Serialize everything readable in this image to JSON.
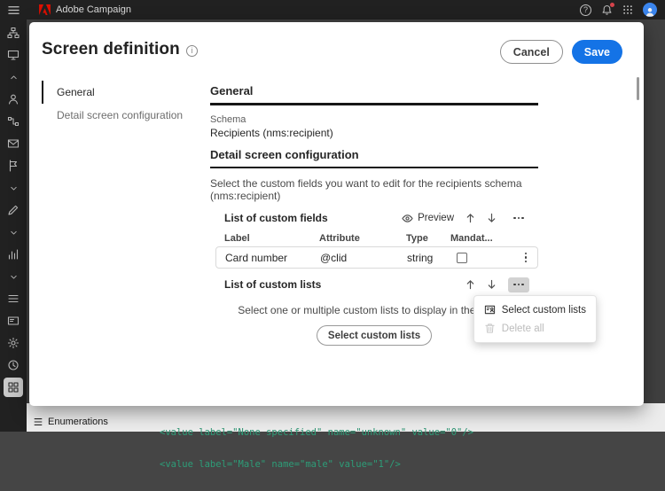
{
  "topbar": {
    "app_name": "Adobe Campaign"
  },
  "sidebar": {
    "icons": [
      "sitemap",
      "monitor",
      "chevron-up",
      "user",
      "workflow",
      "mail",
      "flag",
      "chevron-down",
      "compose",
      "chevron-down",
      "chart",
      "chevron-down",
      "list",
      "card",
      "settings",
      "history",
      "grid"
    ],
    "selected_icon": "grid"
  },
  "background": {
    "enumerations_label": "Enumerations",
    "code_lines": [
      "<value label=\"None specified\" name=\"unknown\" value=\"0\"/>",
      "<value label=\"Male\" name=\"male\" value=\"1\"/>"
    ]
  },
  "modal": {
    "title": "Screen definition",
    "actions": {
      "cancel": "Cancel",
      "save": "Save"
    },
    "nav": {
      "items": [
        {
          "label": "General"
        },
        {
          "label": "Detail screen configuration"
        }
      ],
      "active_index": 0
    },
    "general_section": {
      "heading": "General",
      "schema_label": "Schema",
      "schema_value": "Recipients (nms:recipient)"
    },
    "detail_section": {
      "heading": "Detail screen configuration",
      "description": "Select the custom fields you want to edit for the recipients schema (nms:recipient)",
      "custom_fields": {
        "title": "List of custom fields",
        "preview_label": "Preview",
        "table": {
          "headers": [
            "Label",
            "Attribute",
            "Type",
            "Mandat..."
          ],
          "row": {
            "label": "Card number",
            "attribute": "@clid",
            "type": "string",
            "mandatory_checked": false
          }
        }
      },
      "custom_lists": {
        "title": "List of custom lists",
        "description": "Select one or multiple custom lists to display in the screen",
        "button_label": "Select custom lists"
      }
    },
    "context_menu": {
      "items": [
        {
          "label": "Select custom lists",
          "disabled": false
        },
        {
          "label": "Delete all",
          "disabled": true
        }
      ]
    }
  },
  "colors": {
    "accent_blue": "#1473e6",
    "code_green": "#2d9d78",
    "topbar_bg": "#242424"
  }
}
